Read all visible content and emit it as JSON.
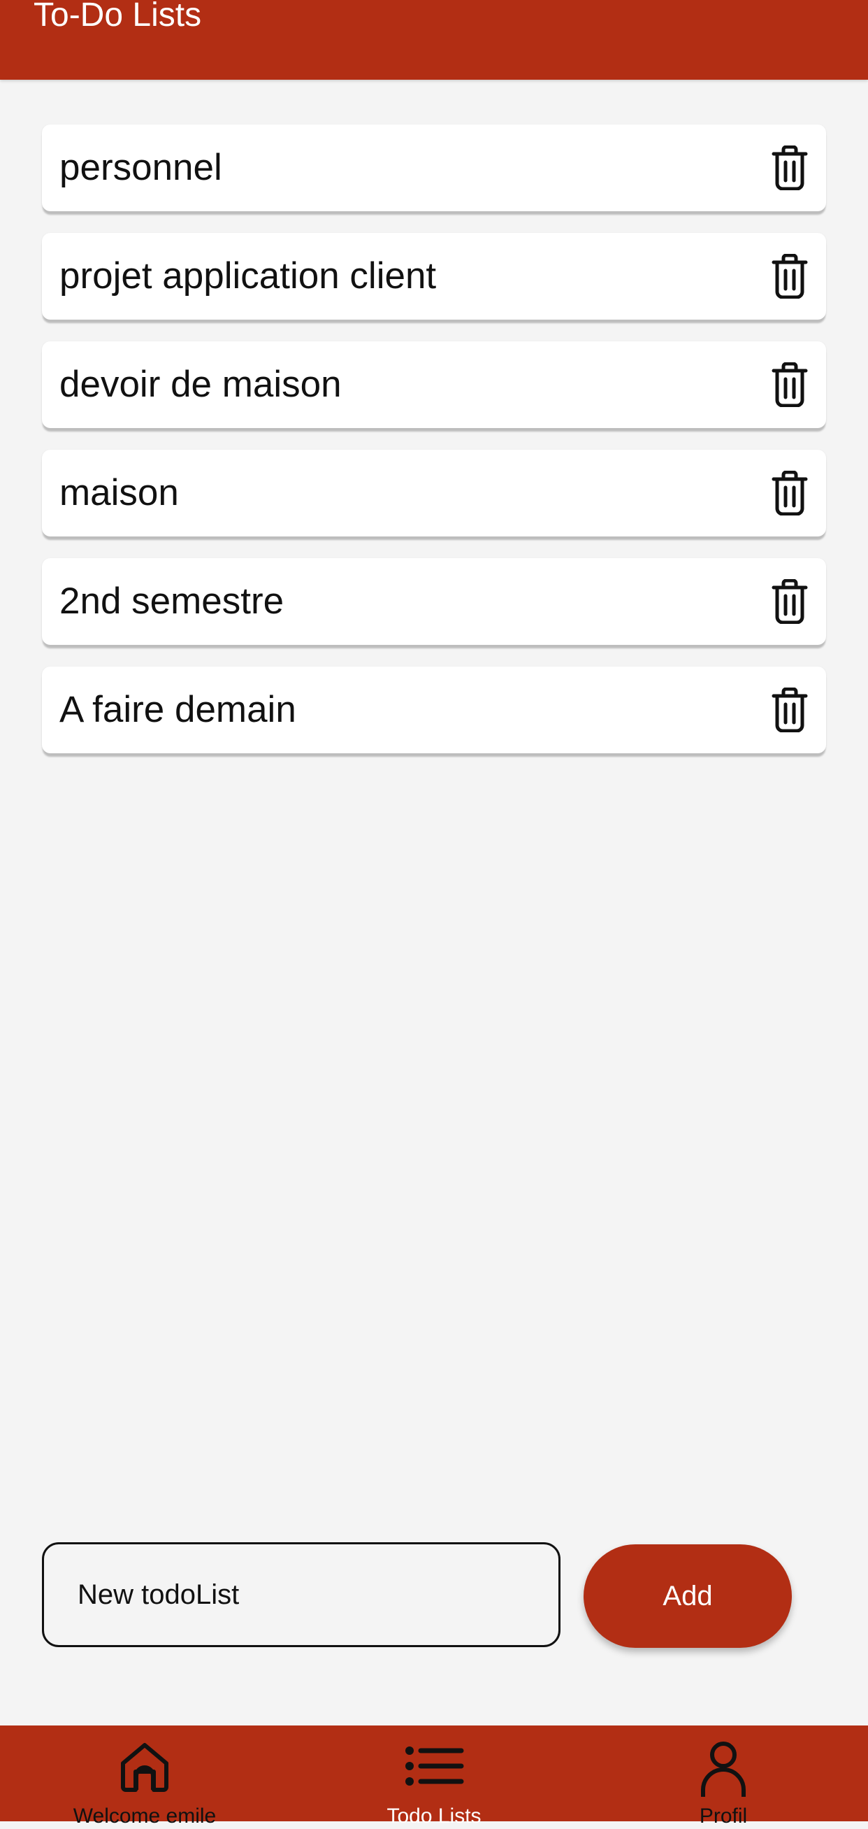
{
  "header": {
    "title": "To-Do Lists"
  },
  "lists": [
    {
      "name": "personnel"
    },
    {
      "name": "projet application client"
    },
    {
      "name": "devoir de maison"
    },
    {
      "name": "maison"
    },
    {
      "name": "2nd semestre"
    },
    {
      "name": "A faire demain"
    }
  ],
  "new_list": {
    "placeholder": "New todoList",
    "value": "",
    "add_label": "Add"
  },
  "nav": {
    "items": [
      {
        "label": "Welcome emile",
        "icon": "home-icon",
        "active": false
      },
      {
        "label": "Todo Lists",
        "icon": "list-icon",
        "active": true
      },
      {
        "label": "Profil",
        "icon": "person-icon",
        "active": false
      }
    ]
  },
  "colors": {
    "primary": "#b22e14",
    "background": "#f4f4f4",
    "card": "#ffffff",
    "text": "#111111"
  },
  "icons": {
    "delete": "trash-icon"
  }
}
